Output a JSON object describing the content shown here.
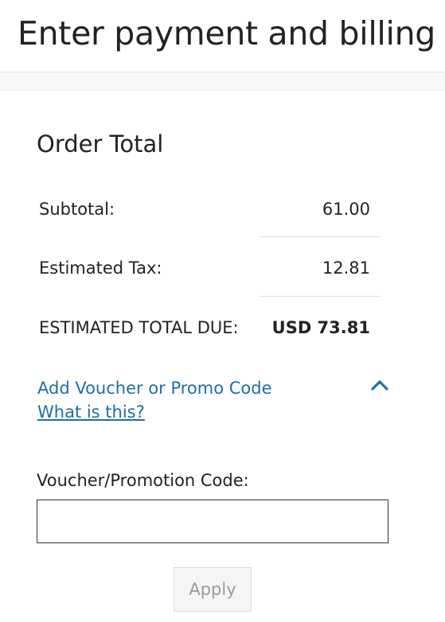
{
  "header": {
    "title": "Enter payment and billing"
  },
  "order_total": {
    "heading": "Order Total",
    "rows": [
      {
        "label": "Subtotal:",
        "value": "61.00"
      },
      {
        "label": "Estimated Tax:",
        "value": "12.81"
      },
      {
        "label": "ESTIMATED TOTAL DUE:",
        "value": "USD 73.81"
      }
    ]
  },
  "promo": {
    "toggle_label": "Add Voucher or Promo Code",
    "toggle_icon": "chevron-up-icon",
    "expanded": true,
    "help_link": "What is this?",
    "field_label": "Voucher/Promotion Code:",
    "field_value": "",
    "field_placeholder": "",
    "apply_label": "Apply",
    "apply_enabled": false
  },
  "colors": {
    "link": "#1e6fa3",
    "text": "#222222",
    "disabled_text": "#9a9a9a"
  }
}
